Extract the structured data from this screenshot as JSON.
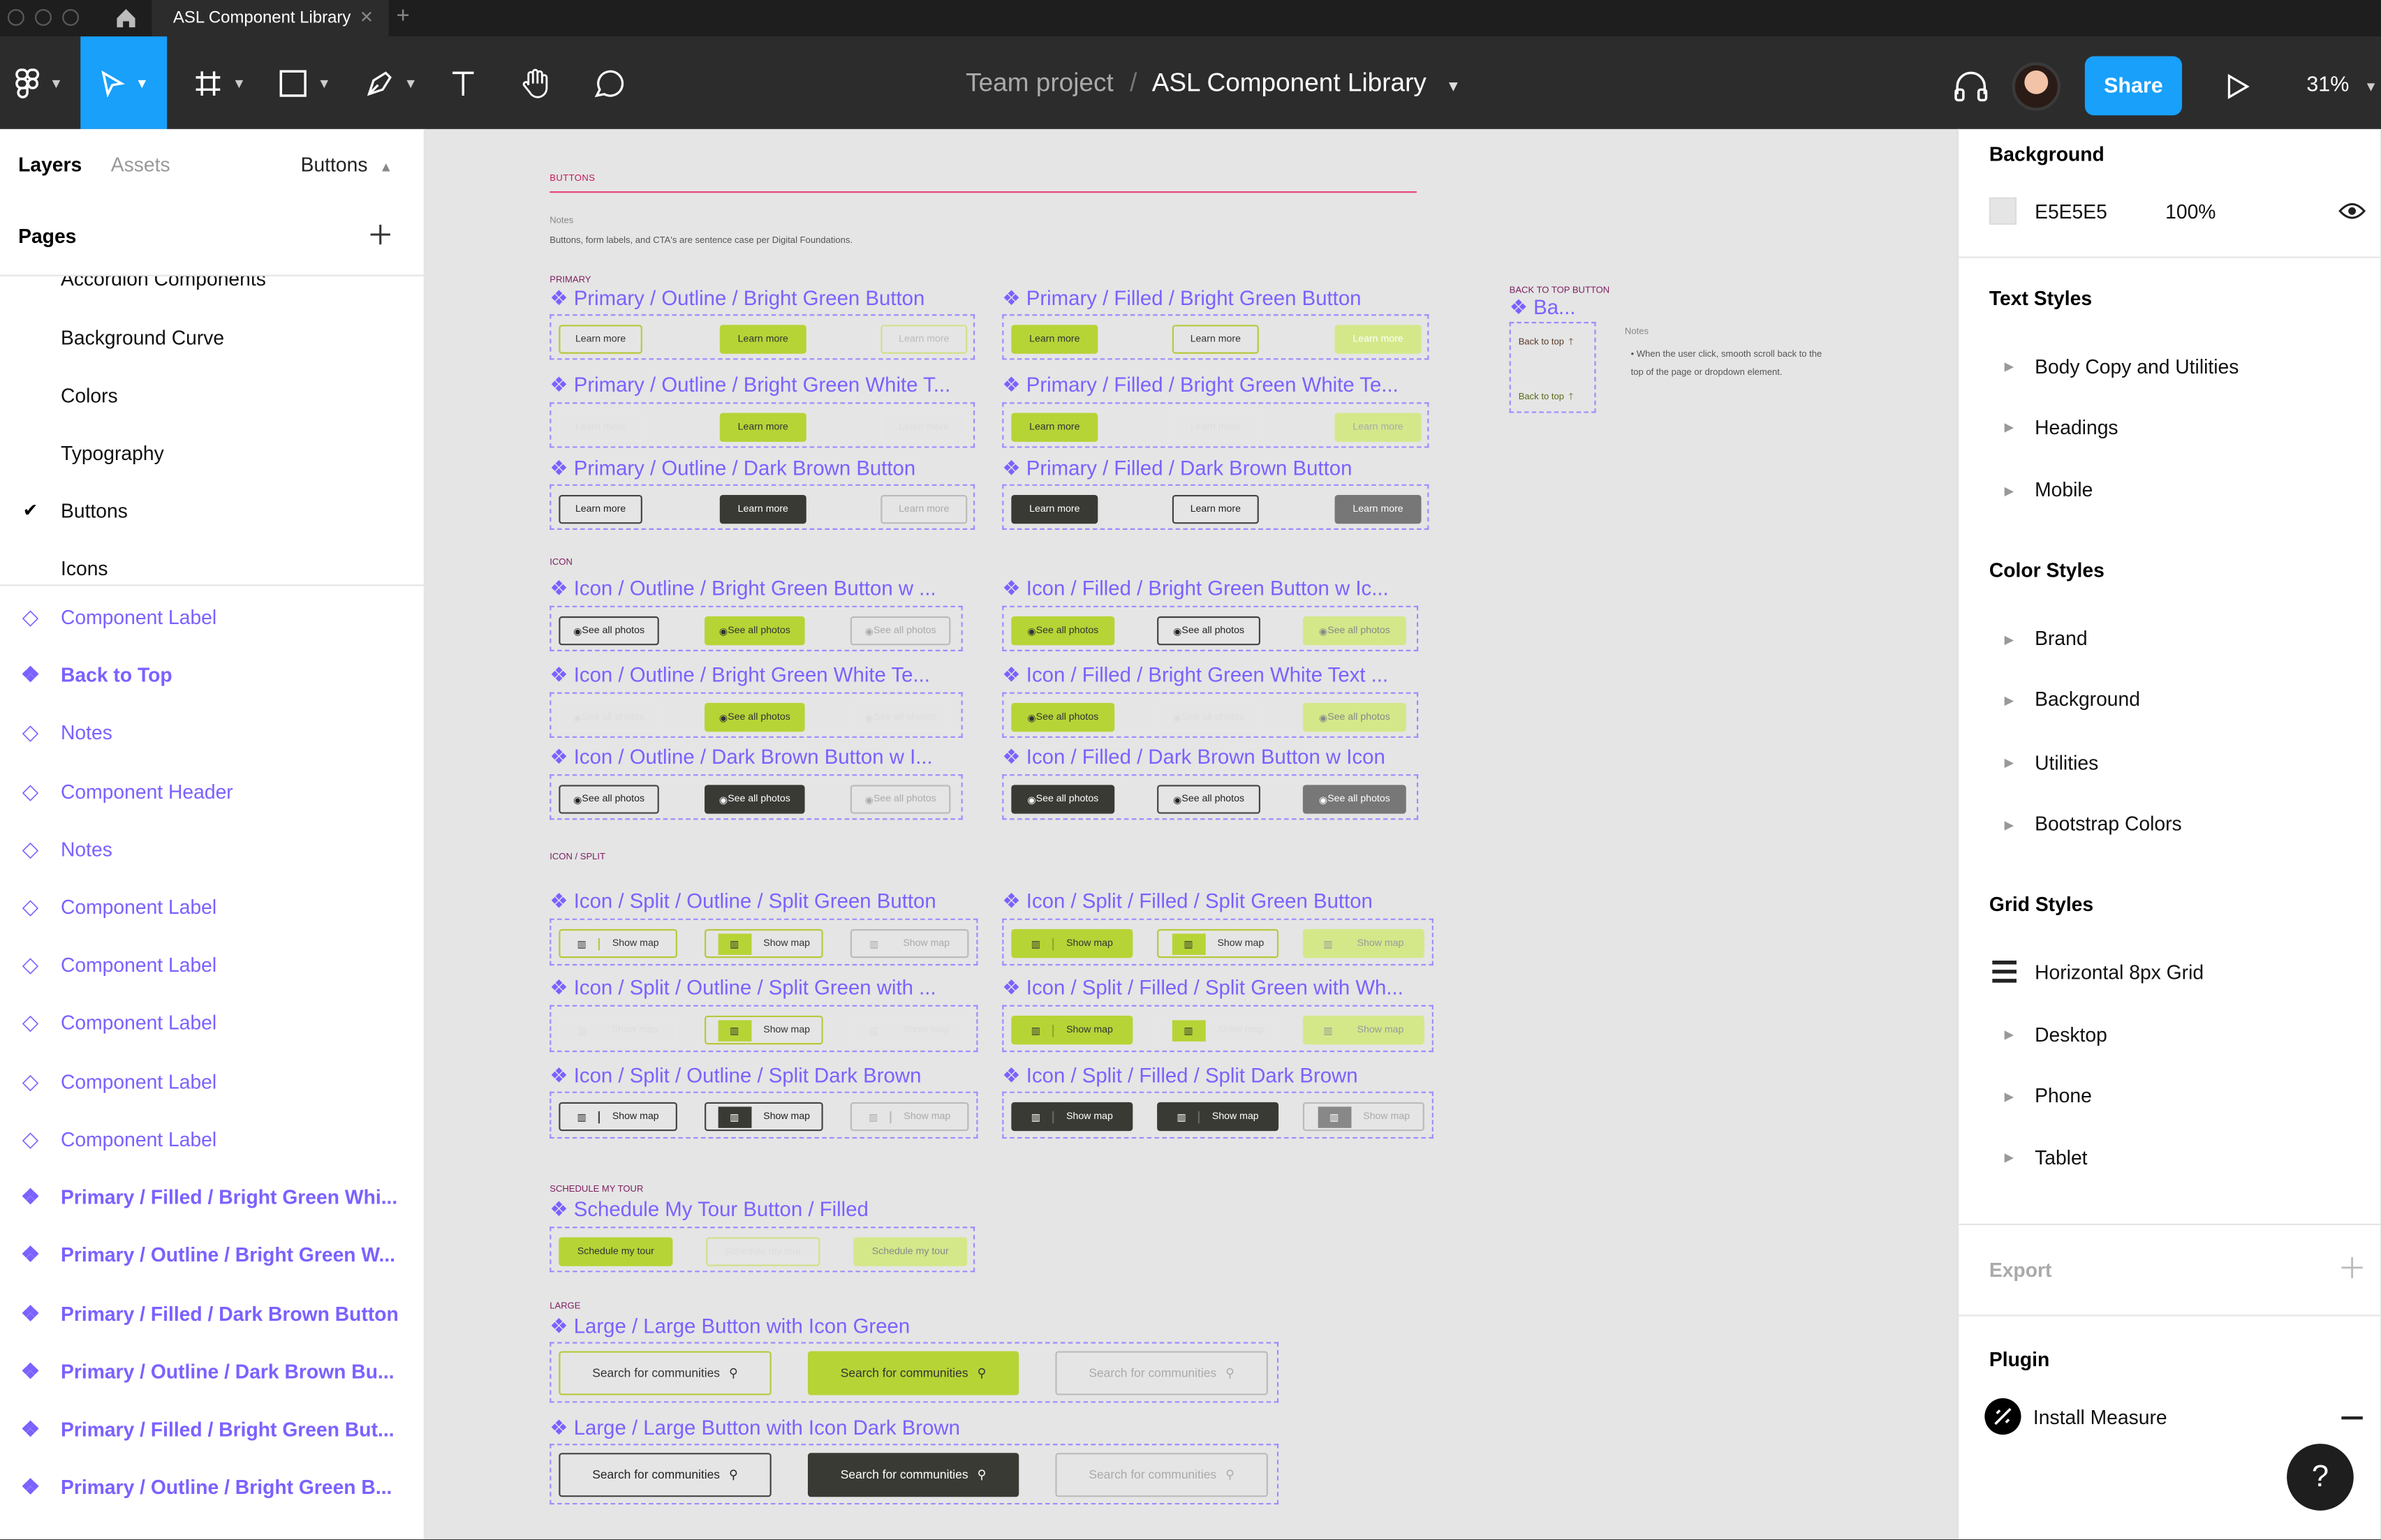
{
  "window": {
    "tab_title": "ASL Component Library"
  },
  "toolbar": {
    "project": "Team project",
    "separator": "/",
    "file": "ASL Component Library",
    "share": "Share",
    "zoom": "31%"
  },
  "left_panel": {
    "tabs": [
      "Layers",
      "Assets"
    ],
    "page_select": "Buttons",
    "pages_title": "Pages",
    "pages": [
      "Accordion Components",
      "Background Curve",
      "Colors",
      "Typography",
      "Buttons",
      "Icons"
    ],
    "current_page": "Buttons",
    "layers": [
      {
        "label": "Component Label",
        "kind": "instance"
      },
      {
        "label": "Back to Top",
        "kind": "component"
      },
      {
        "label": "Notes",
        "kind": "instance"
      },
      {
        "label": "Component Header",
        "kind": "instance"
      },
      {
        "label": "Notes",
        "kind": "instance"
      },
      {
        "label": "Component Label",
        "kind": "instance"
      },
      {
        "label": "Component Label",
        "kind": "instance"
      },
      {
        "label": "Component Label",
        "kind": "instance"
      },
      {
        "label": "Component Label",
        "kind": "instance"
      },
      {
        "label": "Component Label",
        "kind": "instance"
      },
      {
        "label": "Primary / Filled / Bright Green Whi...",
        "kind": "component"
      },
      {
        "label": "Primary / Outline / Bright Green W...",
        "kind": "component"
      },
      {
        "label": "Primary / Filled / Dark Brown Button",
        "kind": "component"
      },
      {
        "label": "Primary / Outline / Dark Brown Bu...",
        "kind": "component"
      },
      {
        "label": "Primary / Filled / Bright Green But...",
        "kind": "component"
      },
      {
        "label": "Primary / Outline / Bright Green B...",
        "kind": "component"
      }
    ]
  },
  "canvas": {
    "page_header": "BUTTONS",
    "notes_label": "Notes",
    "notes_text": "Buttons, form labels, and CTA's are sentence case per Digital Foundations.",
    "sections": {
      "primary": "PRIMARY",
      "icon": "ICON",
      "icon_split": "ICON / SPLIT",
      "tour": "SCHEDULE MY TOUR",
      "large": "LARGE",
      "back_top": "BACK TO TOP BUTTON"
    },
    "button_text": {
      "learn": "Learn more",
      "photos": "See all photos",
      "map": "Show map",
      "tour": "Schedule my tour",
      "search": "Search for communities",
      "back": "Back to top"
    },
    "titles": {
      "p1": "Primary / Outline / Bright Green Button",
      "p2": "Primary / Filled / Bright Green Button",
      "p3": "Primary / Outline / Bright Green White T...",
      "p4": "Primary / Filled / Bright Green White Te...",
      "p5": "Primary / Outline / Dark Brown Button",
      "p6": "Primary / Filled / Dark Brown Button",
      "i1": "Icon / Outline / Bright Green Button w ...",
      "i2": "Icon / Filled / Bright Green Button w Ic...",
      "i3": "Icon / Outline / Bright Green White Te...",
      "i4": "Icon / Filled / Bright Green White Text ...",
      "i5": "Icon / Outline / Dark Brown Button w I...",
      "i6": "Icon / Filled / Dark Brown Button w Icon",
      "s1": "Icon / Split / Outline / Split Green Button",
      "s2": "Icon / Split / Filled / Split Green Button",
      "s3": "Icon / Split / Outline / Split Green with ...",
      "s4": "Icon / Split / Filled / Split Green with Wh...",
      "s5": "Icon / Split / Outline / Split Dark Brown",
      "s6": "Icon / Split / Filled / Split Dark Brown",
      "t1": "Schedule My Tour Button / Filled",
      "l1": "Large / Large Button with Icon Green",
      "l2": "Large / Large Button with Icon Dark Brown",
      "b1": "Ba..."
    },
    "back_notes_label": "Notes",
    "back_notes": "When the user click, smooth scroll back to the top of the page or dropdown element."
  },
  "right_panel": {
    "background_title": "Background",
    "bg_hex": "E5E5E5",
    "bg_opacity": "100%",
    "text_styles_title": "Text Styles",
    "text_styles": [
      "Body Copy and Utilities",
      "Headings",
      "Mobile"
    ],
    "color_styles_title": "Color Styles",
    "color_styles": [
      "Brand",
      "Background",
      "Utilities",
      "Bootstrap Colors"
    ],
    "grid_styles_title": "Grid Styles",
    "grid_styles": [
      "Horizontal 8px Grid",
      "Desktop",
      "Phone",
      "Tablet"
    ],
    "export_title": "Export",
    "plugin_title": "Plugin",
    "plugin_item": "Install Measure"
  },
  "colors": {
    "accent": "#7b61ff",
    "share": "#18a0fb",
    "bright_green": "#b6d436",
    "dark_brown": "#3a3a35",
    "canvas_bg": "#e5e5e5"
  }
}
